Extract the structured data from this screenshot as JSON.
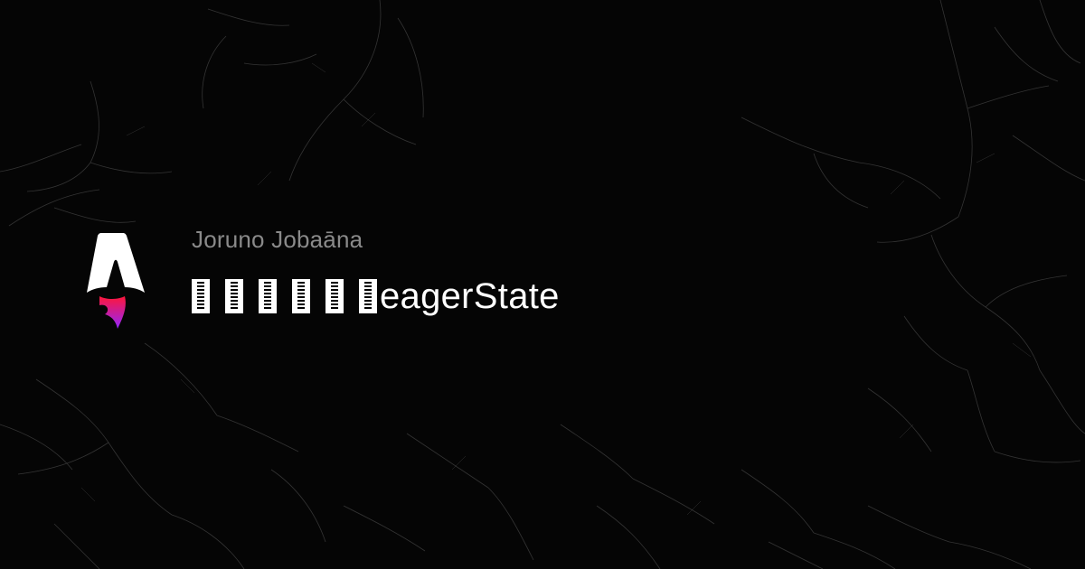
{
  "card": {
    "author": "Joruno Jobaāna",
    "title": "eagerState",
    "missing_glyph_count": 6,
    "logo_icon": "astro-logo-icon",
    "colors": {
      "background": "#050505",
      "author": "#8a8a8a",
      "title": "#ffffff",
      "logo_body": "#ffffff",
      "logo_flame_top": "#ff1639",
      "logo_flame_bottom": "#9225ff"
    }
  }
}
